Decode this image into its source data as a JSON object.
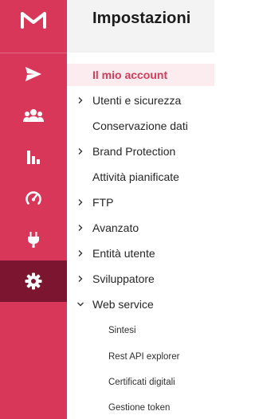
{
  "rail": {
    "logo_icon": "m-logo-icon",
    "items": [
      {
        "icon": "send-icon",
        "active": false
      },
      {
        "icon": "users-icon",
        "active": false
      },
      {
        "icon": "bar-chart-icon",
        "active": false
      },
      {
        "icon": "speedometer-icon",
        "active": false
      },
      {
        "icon": "plug-icon",
        "active": false
      },
      {
        "icon": "gear-icon",
        "active": true
      }
    ],
    "colors": {
      "background": "#d8375a",
      "active": "#7c1530"
    }
  },
  "panel": {
    "title": "Impostazioni",
    "items": [
      {
        "label": "Il mio account",
        "chevron": "none",
        "active": true
      },
      {
        "label": "Utenti e sicurezza",
        "chevron": "right"
      },
      {
        "label": "Conservazione dati",
        "chevron": "none"
      },
      {
        "label": "Brand Protection",
        "chevron": "right"
      },
      {
        "label": "Attività pianificate",
        "chevron": "none"
      },
      {
        "label": "FTP",
        "chevron": "right"
      },
      {
        "label": "Avanzato",
        "chevron": "right"
      },
      {
        "label": "Entità utente",
        "chevron": "right"
      },
      {
        "label": "Sviluppatore",
        "chevron": "right"
      },
      {
        "label": "Web service",
        "chevron": "down"
      }
    ],
    "subitems": [
      {
        "label": "Sintesi"
      },
      {
        "label": "Rest API explorer"
      },
      {
        "label": "Certificati digitali"
      },
      {
        "label": "Gestione token"
      }
    ],
    "colors": {
      "accent": "#d23d5a",
      "active_bg": "#fcecef",
      "header_bg": "#f3f3f4"
    }
  }
}
